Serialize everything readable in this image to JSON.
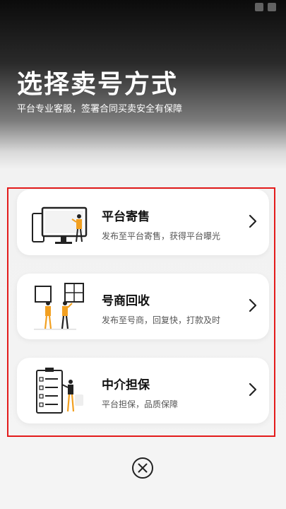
{
  "header": {
    "title": "选择卖号方式",
    "subtitle": "平台专业客服，签署合同买卖安全有保障"
  },
  "options": [
    {
      "title": "平台寄售",
      "description": "发布至平台寄售，获得平台曝光",
      "illustration": "computer-screen-person-illustration",
      "arrow_icon": "chevron-right-icon"
    },
    {
      "title": "号商回收",
      "description": "发布至号商，回复快，打款及时",
      "illustration": "two-people-window-illustration",
      "arrow_icon": "chevron-right-icon"
    },
    {
      "title": "中介担保",
      "description": "平台担保，品质保障",
      "illustration": "checklist-person-illustration",
      "arrow_icon": "chevron-right-icon"
    }
  ],
  "close_icon": "close-circle-icon",
  "colors": {
    "highlight_border": "#e31b1b",
    "accent_orange": "#f2a021",
    "card_bg": "#ffffff",
    "title_text": "#111111"
  }
}
